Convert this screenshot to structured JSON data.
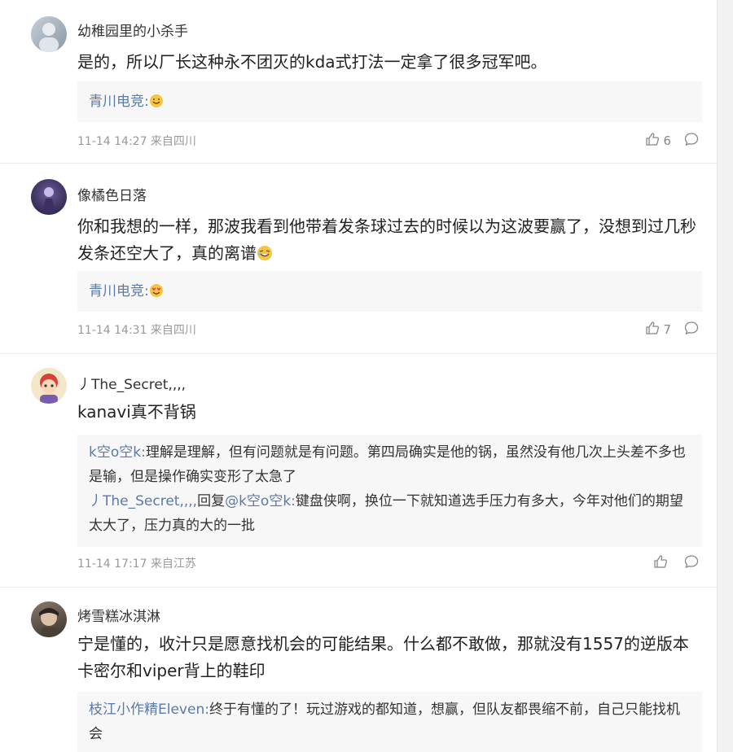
{
  "comments": [
    {
      "name": "幼稚园里的小杀手",
      "text": "是的，所以厂长这种永不团灭的kda式打法一定拿了很多冠军吧。",
      "reply_author": "青川电竞:",
      "reply_text": "",
      "meta": "11-14 14:27 来自四川",
      "likes": "6"
    },
    {
      "name": "像橘色日落",
      "text": "你和我想的一样，那波我看到他带着发条球过去的时候以为这波要赢了，没想到过几秒发条还空大了，真的离谱",
      "reply_author": "青川电竞:",
      "reply_text": "",
      "meta": "11-14 14:31 来自四川",
      "likes": "7"
    },
    {
      "name": "丿The_Secret,,,,",
      "text": "kanavi真不背锅",
      "reply1_author": "k空o空k:",
      "reply1_text": "理解是理解，但有问题就是有问题。第四局确实是他的锅，虽然没有他几次上头差不多也是输，但是操作确实变形了太急了",
      "reply2_author": "丿The_Secret,,,,",
      "reply2_mid": "回复",
      "reply2_target": "@k空o空k:",
      "reply2_text": "键盘侠啊，换位一下就知道选手压力有多大，今年对他们的期望太大了，压力真的大的一批",
      "meta": "11-14 17:17 来自江苏",
      "likes": ""
    },
    {
      "name": "烤雪糕冰淇淋",
      "text": "宁是懂的，收汁只是愿意找机会的可能结果。什么都不敢做，那就没有1557的逆版本卡密尔和viper背上的鞋印",
      "reply_author": "枝江小作精Eleven:",
      "reply_text": "终于有懂的了！玩过游戏的都知道，想赢，但队友都畏缩不前，自己只能找机会"
    }
  ],
  "colors": {
    "link": "#5b7aa6",
    "meta": "#999999",
    "reply_bg": "#f7f7f7"
  }
}
